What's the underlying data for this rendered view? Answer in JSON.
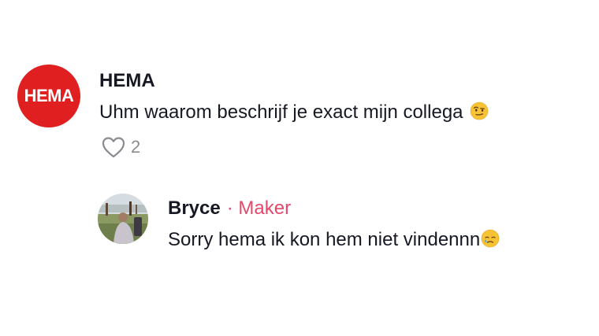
{
  "comment": {
    "avatar_text": "HEMA",
    "username": "HEMA",
    "text": "Uhm waarom beschrijf je exact mijn collega",
    "emoji": "raised-eyebrow-emoji",
    "like_count": "2",
    "colors": {
      "avatar_bg": "#e02020",
      "text": "#161823",
      "meta": "#8a8b91"
    }
  },
  "reply": {
    "username": "Bryce",
    "creator_tag": "· Maker",
    "text": "Sorry hema ik kon hem niet vindennn",
    "emoji": "sad-tear-emoji",
    "colors": {
      "creator_tag": "#e6476b"
    }
  }
}
